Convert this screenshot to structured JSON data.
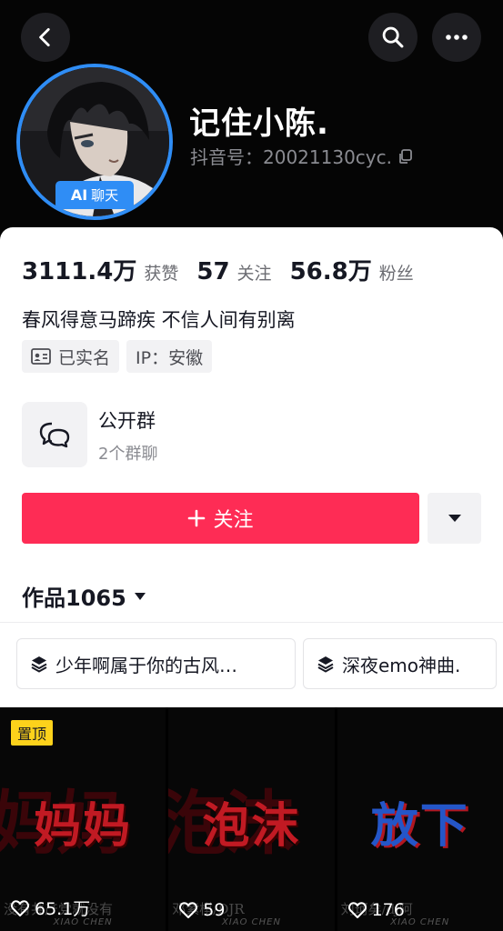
{
  "header": {
    "nickname": "记住小陈.",
    "douyin_id": "抖音号：20021130cyc.",
    "ai_badge_ai": "AI",
    "ai_badge_label": "聊天"
  },
  "stats": {
    "likes_value": "3111.4万",
    "likes_label": "获赞",
    "following_value": "57",
    "following_label": "关注",
    "followers_value": "56.8万",
    "followers_label": "粉丝"
  },
  "bio": "春风得意马蹄疾 不信人间有别离",
  "tags": {
    "verified": "已实名",
    "ip": "IP：安徽"
  },
  "group": {
    "title": "公开群",
    "subtitle": "2个群聊"
  },
  "follow_button": "关注",
  "works": {
    "tab_label": "作品1065"
  },
  "collections": [
    {
      "label": "少年啊属于你的古风…"
    },
    {
      "label": "深夜emo神曲."
    }
  ],
  "videos": [
    {
      "pinned": "置顶",
      "title": "妈妈",
      "bg": "妈妈",
      "lyric": "没有共产党就没有",
      "watermark": "XIAO CHEN",
      "likes": "65.1万",
      "color": "#c11a23"
    },
    {
      "pinned": "",
      "title": "泡沫",
      "bg": "泡沫",
      "lyric": "邓紫棋/DJR",
      "watermark": "XIAO CHEN",
      "likes": "59",
      "color": "#c11a23"
    },
    {
      "pinned": "",
      "title": "放下",
      "bg": "",
      "lyric": "刘珂矣/dj阿",
      "watermark": "XIAO CHEN",
      "likes": "176",
      "color": "#2456c8"
    }
  ],
  "colors": {
    "accent": "#fe2c55",
    "ai_blue": "#2f8df5",
    "pinned": "#fdd21b"
  }
}
